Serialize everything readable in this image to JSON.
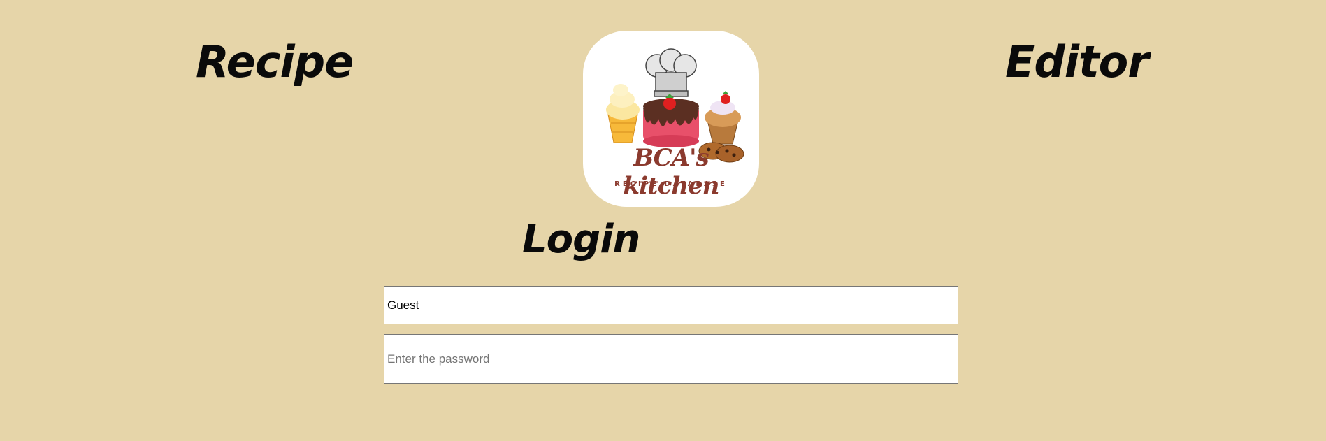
{
  "header": {
    "left_title": "Recipe",
    "right_title": "Editor"
  },
  "logo": {
    "brand_name": "BCA's kitchen",
    "tagline": "RECIPE DATABASE",
    "icon_names": [
      "ice-cream-icon",
      "chef-hat-icon",
      "cake-icon",
      "muffin-icon",
      "cookies-icon"
    ]
  },
  "login": {
    "heading": "Login",
    "username_value": "Guest",
    "password_placeholder": "Enter the password"
  },
  "colors": {
    "background": "#e6d5a9",
    "logo_text": "#8b3a2e",
    "input_border": "#767676"
  }
}
